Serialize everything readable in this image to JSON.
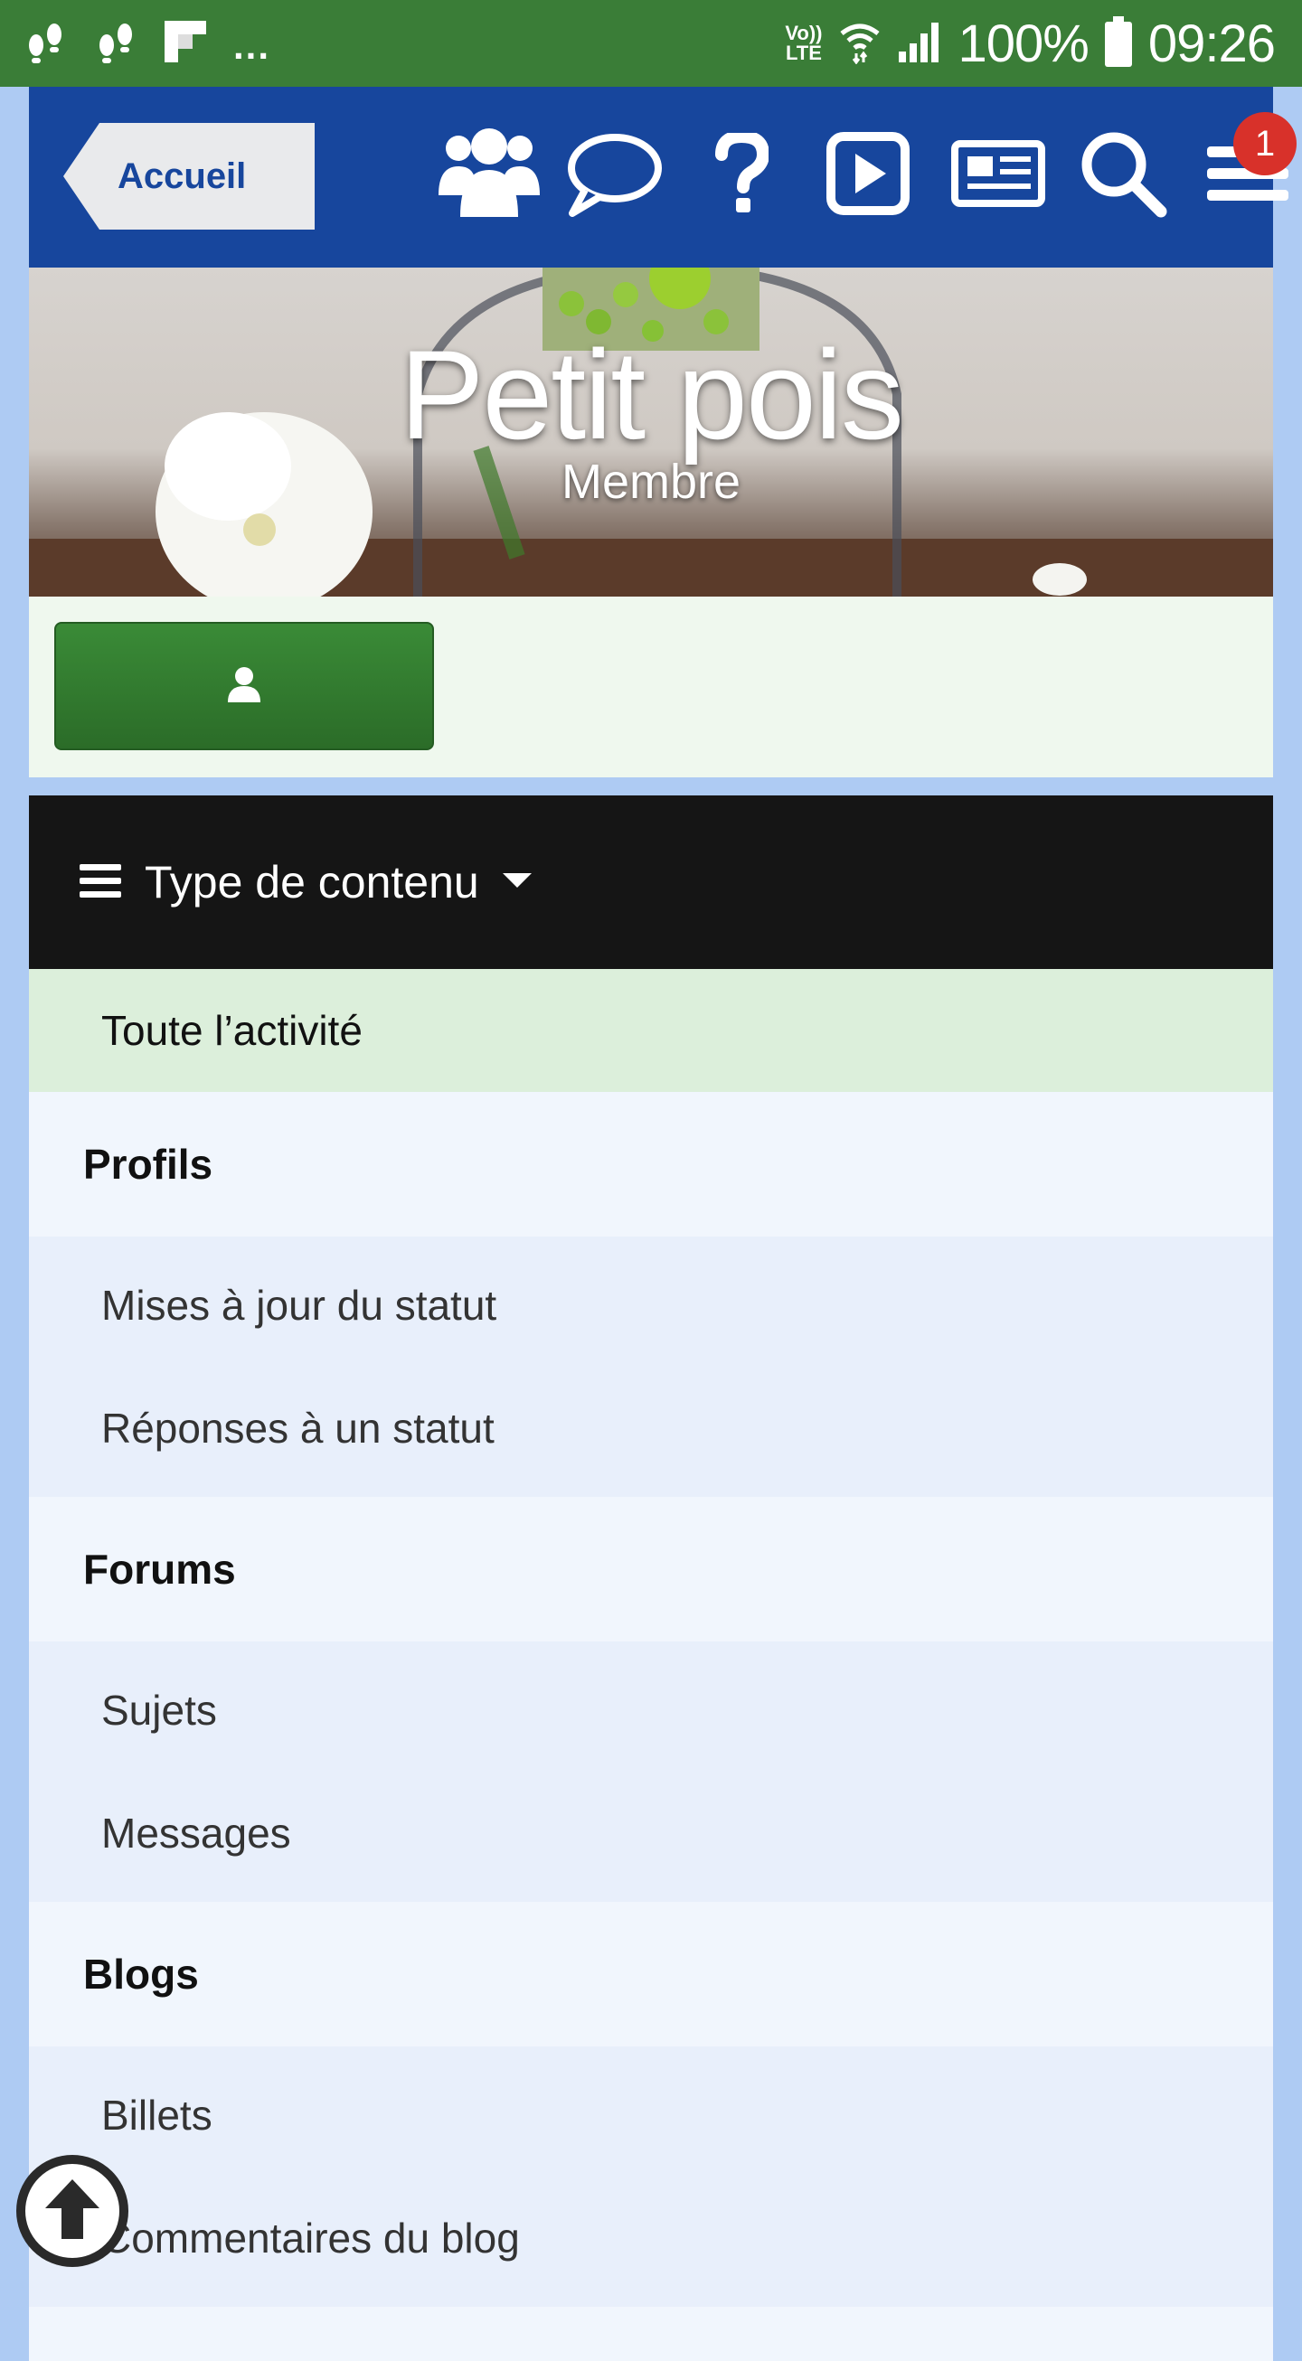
{
  "status_bar": {
    "battery": "100%",
    "time": "09:26",
    "network_label": "LTE",
    "volte_label": "Vo))",
    "overflow": "..."
  },
  "nav": {
    "back_label": "Accueil",
    "notification_count": "1",
    "icons": [
      "members-icon",
      "chat-icon",
      "help-icon",
      "video-icon",
      "news-icon",
      "search-icon",
      "menu-icon"
    ]
  },
  "profile": {
    "name": "Petit pois",
    "role": "Membre"
  },
  "content_menu": {
    "title": "Type de contenu",
    "active_item": "Toute l’activité",
    "sections": [
      {
        "label": "Profils",
        "items": [
          "Mises à jour du statut",
          "Réponses à un statut"
        ]
      },
      {
        "label": "Forums",
        "items": [
          "Sujets",
          "Messages"
        ]
      },
      {
        "label": "Blogs",
        "items": [
          "Billets",
          "Commentaires du blog"
        ]
      }
    ]
  },
  "colors": {
    "status_bar": "#3a7d37",
    "nav_bar": "#17469d",
    "menu_header": "#151515",
    "active_row": "#dcefdb",
    "badge": "#d8312a",
    "follow_button": "#2f7a2c"
  }
}
